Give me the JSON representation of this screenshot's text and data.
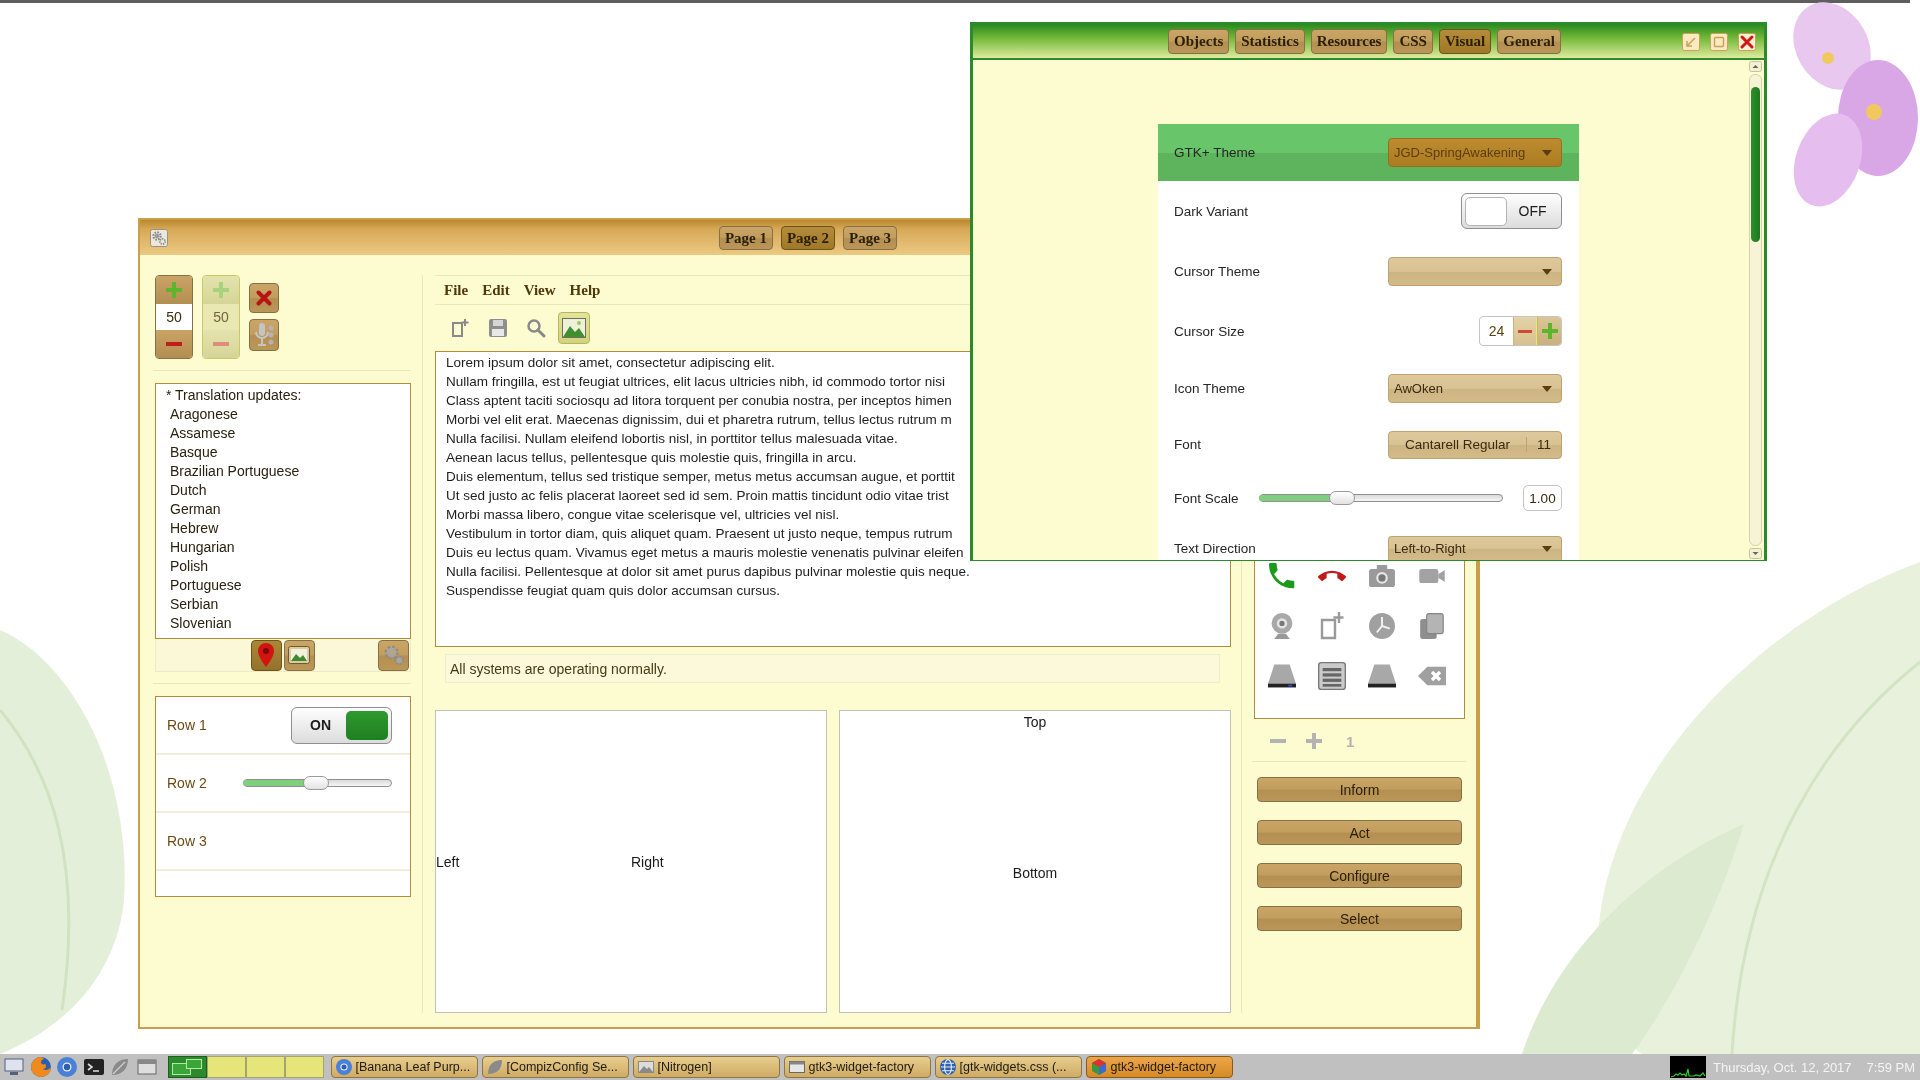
{
  "main_window": {
    "title_tabs": [
      {
        "label": "Page 1",
        "selected": false
      },
      {
        "label": "Page 2",
        "selected": true
      },
      {
        "label": "Page 3",
        "selected": false
      }
    ],
    "spin_buttons": [
      {
        "value": "50",
        "disabled": false
      },
      {
        "value": "50",
        "disabled": true
      }
    ],
    "languages": {
      "header": "* Translation updates:",
      "items": [
        "Aragonese",
        "Assamese",
        "Basque",
        "Brazilian Portuguese",
        "Dutch",
        "German",
        "Hebrew",
        "Hungarian",
        "Polish",
        "Portuguese",
        "Serbian",
        "Slovenian"
      ]
    },
    "list_toolbar": [
      {
        "kind": "pin",
        "toggled": true
      },
      {
        "kind": "image",
        "toggled": false
      },
      {
        "kind": "gears",
        "toggled": false
      }
    ],
    "rows": [
      {
        "label": "Row 1",
        "kind": "switch",
        "on": true,
        "switch_text": "ON"
      },
      {
        "label": "Row 2",
        "kind": "slider",
        "level": 0.49
      },
      {
        "label": "Row 3",
        "kind": "plain"
      }
    ],
    "menu": [
      "File",
      "Edit",
      "View",
      "Help"
    ],
    "toolbar": [
      {
        "kind": "new",
        "toggled": false
      },
      {
        "kind": "save",
        "toggled": false
      },
      {
        "kind": "search",
        "toggled": false
      },
      {
        "kind": "image",
        "toggled": true
      }
    ],
    "text_lines": [
      "Lorem ipsum dolor sit amet, consectetur adipiscing elit.",
      "Nullam fringilla, est ut feugiat ultrices, elit lacus ultricies nibh, id commodo tortor nisi",
      "Class aptent taciti sociosqu ad litora torquent per conubia nostra, per inceptos himen",
      "Morbi vel elit erat. Maecenas dignissim, dui et pharetra rutrum, tellus lectus rutrum m",
      "Nulla facilisi. Nullam eleifend lobortis nisl, in porttitor tellus malesuada vitae.",
      "Aenean lacus tellus, pellentesque quis molestie quis, fringilla in arcu.",
      "Duis elementum, tellus sed tristique semper, metus metus accumsan augue, et porttit",
      "Ut sed justo ac felis placerat laoreet sed id sem. Proin mattis tincidunt odio vitae trist",
      "Morbi massa libero, congue vitae scelerisque vel, ultricies vel nisl.",
      "Vestibulum in tortor diam, quis aliquet quam. Praesent ut justo neque, tempus rutrum",
      "Duis eu lectus quam. Vivamus eget metus a mauris molestie venenatis pulvinar eleifen",
      "Nulla facilisi. Pellentesque at dolor sit amet purus dapibus pulvinar molestie quis neque.",
      "Suspendisse feugiat quam quis dolor accumsan cursus."
    ],
    "info_message": "All systems are operating normally.",
    "panes": {
      "horizontal": [
        "Left",
        "Right"
      ],
      "vertical": [
        "Top",
        "Bottom"
      ]
    },
    "icon_toolbar": {
      "disabled": true,
      "label": "1"
    },
    "buttons": [
      "Inform",
      "Act",
      "Configure",
      "Select"
    ]
  },
  "inspector": {
    "tabs": [
      {
        "label": "Objects",
        "selected": false
      },
      {
        "label": "Statistics",
        "selected": false
      },
      {
        "label": "Resources",
        "selected": false
      },
      {
        "label": "CSS",
        "selected": false
      },
      {
        "label": "Visual",
        "selected": true
      },
      {
        "label": "General",
        "selected": false
      }
    ],
    "settings": [
      {
        "label": "GTK+ Theme",
        "kind": "combo",
        "value": "JGD-SpringAwakening",
        "selected": true
      },
      {
        "label": "Dark Variant",
        "kind": "switch",
        "on": false,
        "switch_text": "OFF",
        "selected": false
      },
      {
        "label": "Cursor Theme",
        "kind": "combo",
        "selected": false
      },
      {
        "label": "Cursor Size",
        "kind": "spin",
        "value": "24",
        "selected": false
      },
      {
        "label": "Icon Theme",
        "kind": "combo",
        "value": "AwOken",
        "selected": false
      },
      {
        "label": "Font",
        "kind": "font",
        "value": "Cantarell Regular",
        "size": "11",
        "selected": false
      },
      {
        "label": "Font Scale",
        "kind": "scale",
        "level": 0.34,
        "value": "1.00",
        "selected": false
      },
      {
        "label": "Text Direction",
        "kind": "combo",
        "value": "Left-to-Right",
        "selected": false
      }
    ]
  },
  "taskbar": {
    "workspaces": [
      {
        "selected": true
      },
      {
        "selected": false
      },
      {
        "selected": false
      },
      {
        "selected": false
      }
    ],
    "tasks": [
      {
        "label": "[Banana Leaf Purp...",
        "kind": "browser",
        "selected": false
      },
      {
        "label": "[CompizConfig Se...",
        "kind": "compiz",
        "selected": false
      },
      {
        "label": "[Nitrogen]",
        "kind": "nitrogen",
        "selected": false
      },
      {
        "label": "gtk3-widget-factory",
        "kind": "window",
        "selected": false
      },
      {
        "label": "[gtk-widgets.css (...",
        "kind": "editor",
        "selected": false
      },
      {
        "label": "gtk3-widget-factory",
        "kind": "gtk",
        "selected": true
      }
    ],
    "clock": {
      "date": "Thursday, Oct. 12, 2017",
      "time": "7:59 PM"
    }
  }
}
